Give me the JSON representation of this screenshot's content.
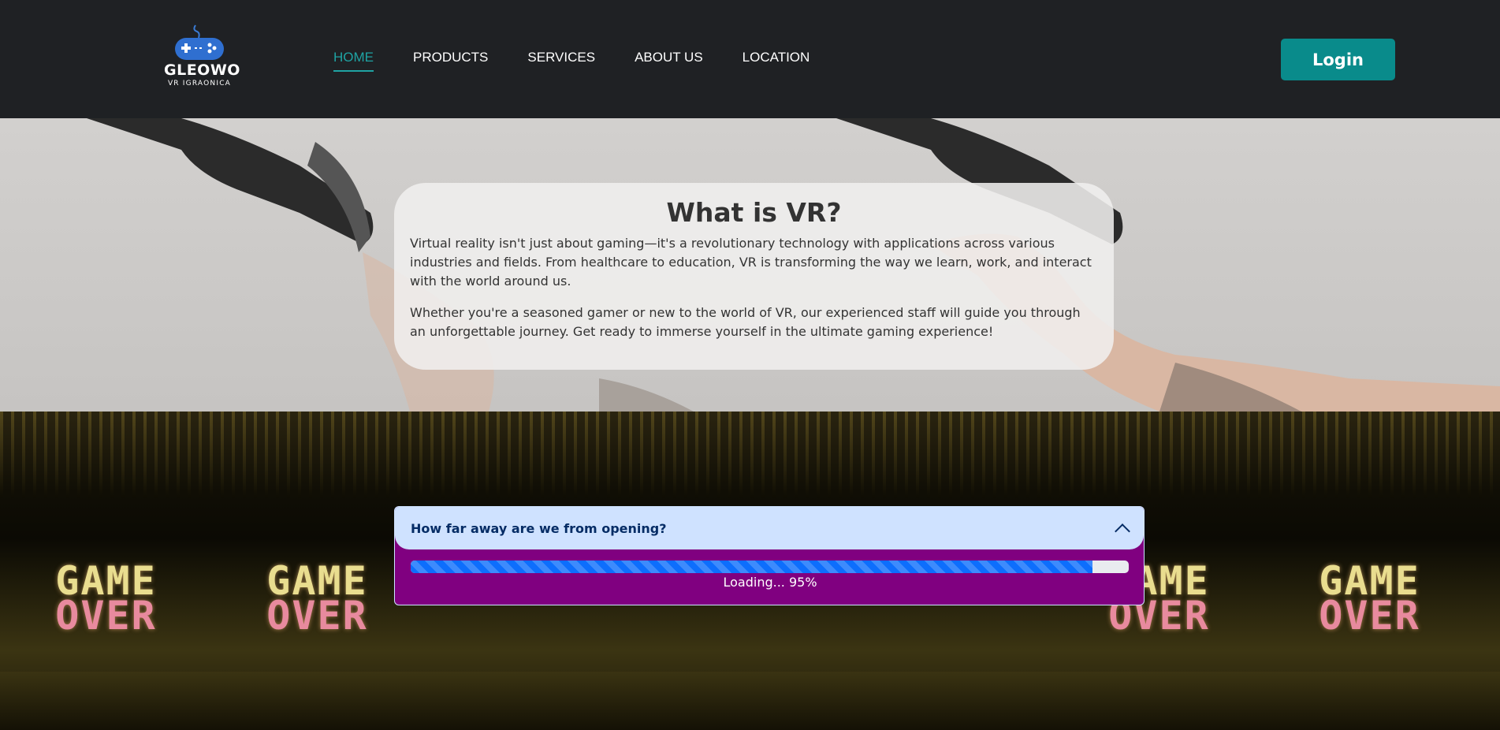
{
  "brand": {
    "name": "GLEOWO",
    "tagline": "VR IGRAONICA"
  },
  "nav": {
    "items": [
      {
        "label": "HOME",
        "active": true
      },
      {
        "label": "PRODUCTS",
        "active": false
      },
      {
        "label": "SERVICES",
        "active": false
      },
      {
        "label": "ABOUT US",
        "active": false
      },
      {
        "label": "LOCATION",
        "active": false
      }
    ],
    "login_label": "Login"
  },
  "hero": {
    "title": "What is VR?",
    "paragraph_1": "Virtual reality isn't just about gaming—it's a revolutionary technology with applications across various industries and fields. From healthcare to education, VR is transforming the way we learn, work, and interact with the world around us.",
    "paragraph_2": "Whether you're a seasoned gamer or new to the world of VR, our experienced staff will guide you through an unforgettable journey. Get ready to immerse yourself in the ultimate gaming experience!"
  },
  "arcade": {
    "sign_line_1": "GAME",
    "sign_line_2": "OVER"
  },
  "opening": {
    "question": "How far away are we from opening?",
    "progress_percent": 95,
    "progress_label": "Loading... 95%"
  },
  "colors": {
    "accent": "#098b8b",
    "nav_active": "#1fa3a3",
    "header_bg": "#1f2124",
    "widget_bg": "#800080",
    "widget_head": "#cfe2ff",
    "progress_fill": "#0d6efd"
  },
  "icons": {
    "logo": "gamepad-icon",
    "toggle": "chevron-up-icon"
  }
}
